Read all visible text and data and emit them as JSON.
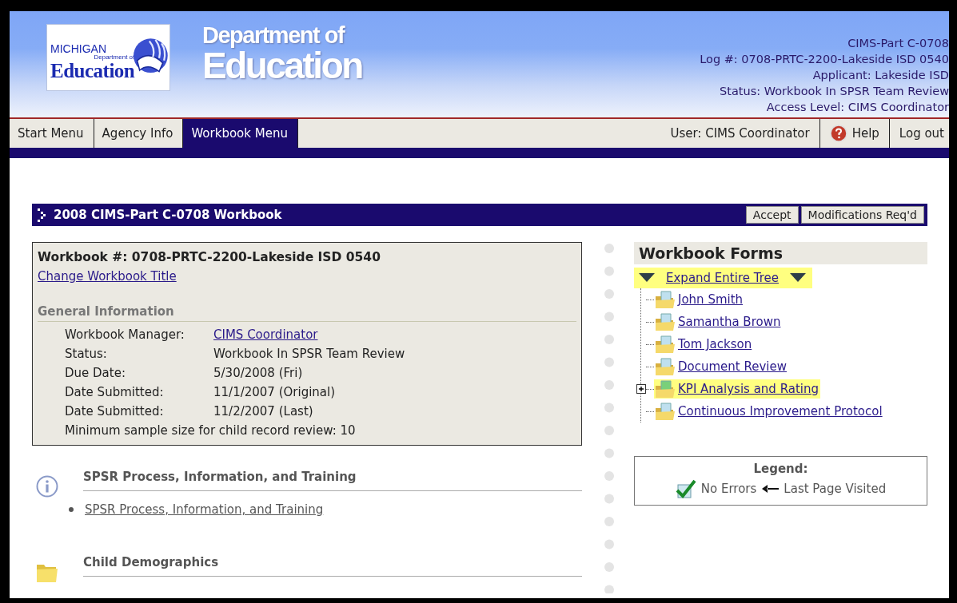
{
  "header": {
    "logo": {
      "state": "MICHIGAN",
      "small": "Department of",
      "name": "Education"
    },
    "title": [
      "Department of",
      "Education"
    ],
    "info": [
      "CIMS-Part C-0708",
      "Log #: 0708-PRTC-2200-Lakeside ISD 0540",
      "Applicant: Lakeside ISD",
      "Status: Workbook In SPSR Team Review",
      "Access Level: CIMS Coordinator"
    ]
  },
  "nav": {
    "tabs": [
      {
        "label": "Start Menu",
        "selected": false
      },
      {
        "label": "Agency Info",
        "selected": false
      },
      {
        "label": "Workbook Menu",
        "selected": true
      }
    ],
    "user": "User: CIMS Coordinator",
    "help": "Help",
    "logout": "Log out"
  },
  "workbook": {
    "title": "2008 CIMS-Part C-0708 Workbook",
    "buttons": [
      "Accept",
      "Modifications Req'd"
    ],
    "number": "Workbook #: 0708-PRTC-2200-Lakeside ISD 0540",
    "change_link": "Change Workbook Title",
    "general_heading": "General Information",
    "rows": [
      {
        "label": "Workbook Manager:",
        "value": "CIMS Coordinator",
        "kind": "link"
      },
      {
        "label": "Status:",
        "value": "Workbook In SPSR Team Review",
        "kind": "text"
      },
      {
        "label": "Due Date:",
        "value": "5/30/2008 (Fri)",
        "kind": "text"
      },
      {
        "label": "Date Submitted:",
        "value": "11/1/2007 (Original)",
        "kind": "text"
      },
      {
        "label": "Date Submitted:",
        "value": "11/2/2007 (Last)",
        "kind": "text"
      }
    ],
    "min_sample": "Minimum sample size for child record review: 10"
  },
  "sections": [
    {
      "heading": "SPSR Process, Information, and Training",
      "kind": "info",
      "links": [
        "SPSR Process, Information, and Training"
      ]
    },
    {
      "heading": "Child Demographics",
      "kind": "folder"
    }
  ],
  "forms": {
    "title": "Workbook Forms",
    "expand": "Expand Entire Tree",
    "items": [
      {
        "label": "John Smith",
        "highlighted": false,
        "expandable": false
      },
      {
        "label": "Samantha Brown",
        "highlighted": false,
        "expandable": false
      },
      {
        "label": "Tom Jackson",
        "highlighted": false,
        "expandable": false
      },
      {
        "label": "Document Review",
        "highlighted": false,
        "expandable": false
      },
      {
        "label": "KPI Analysis and Rating",
        "highlighted": true,
        "expandable": true
      },
      {
        "label": "Continuous Improvement Protocol",
        "highlighted": false,
        "expandable": false
      }
    ]
  },
  "legend": {
    "title": "Legend:",
    "no_errors": "No Errors",
    "last_page": "Last Page Visited"
  }
}
